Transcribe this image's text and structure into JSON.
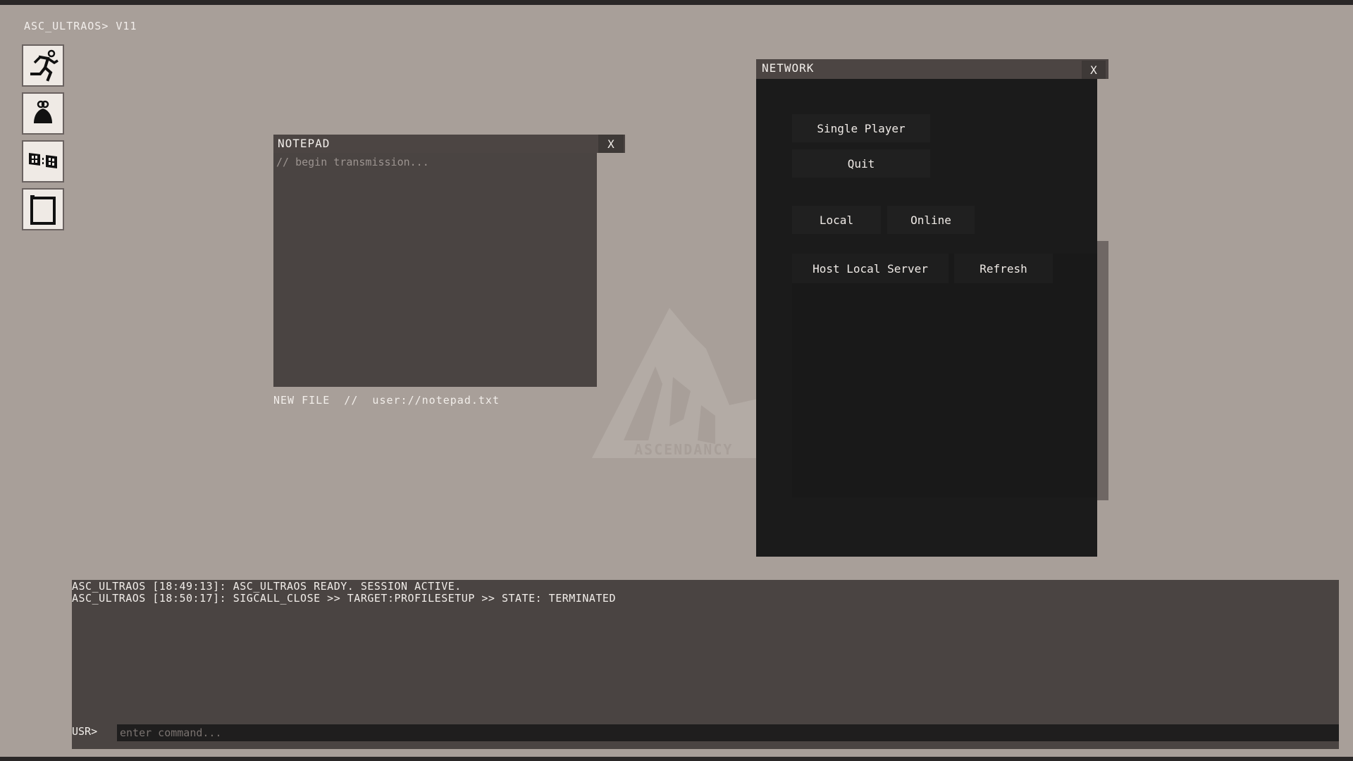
{
  "os": {
    "title": "ASC_ULTRAOS> V11"
  },
  "dock": {
    "items": [
      {
        "icon": "running-man-icon"
      },
      {
        "icon": "user-icon"
      },
      {
        "icon": "clock-icon"
      },
      {
        "icon": "notepad-icon"
      }
    ]
  },
  "notepad": {
    "title": "NOTEPAD",
    "close": "X",
    "placeholder": "// begin transmission...",
    "footer": "NEW FILE  //  user://notepad.txt"
  },
  "watermark": {
    "text": "ASCENDANCY",
    "letters": "ASC"
  },
  "network": {
    "title": "NETWORK",
    "close": "X",
    "single_player": "Single Player",
    "quit": "Quit",
    "local": "Local",
    "online": "Online",
    "host_local_server": "Host Local Server",
    "refresh": "Refresh"
  },
  "console": {
    "lines": [
      "ASC_ULTRAOS [18:49:13]: ASC_ULTRAOS READY. SESSION ACTIVE.",
      "ASC_ULTRAOS [18:50:17]: SIGCALL_CLOSE >> TARGET:PROFILESETUP >> STATE: TERMINATED"
    ],
    "prompt": "USR>",
    "placeholder": "enter command..."
  }
}
